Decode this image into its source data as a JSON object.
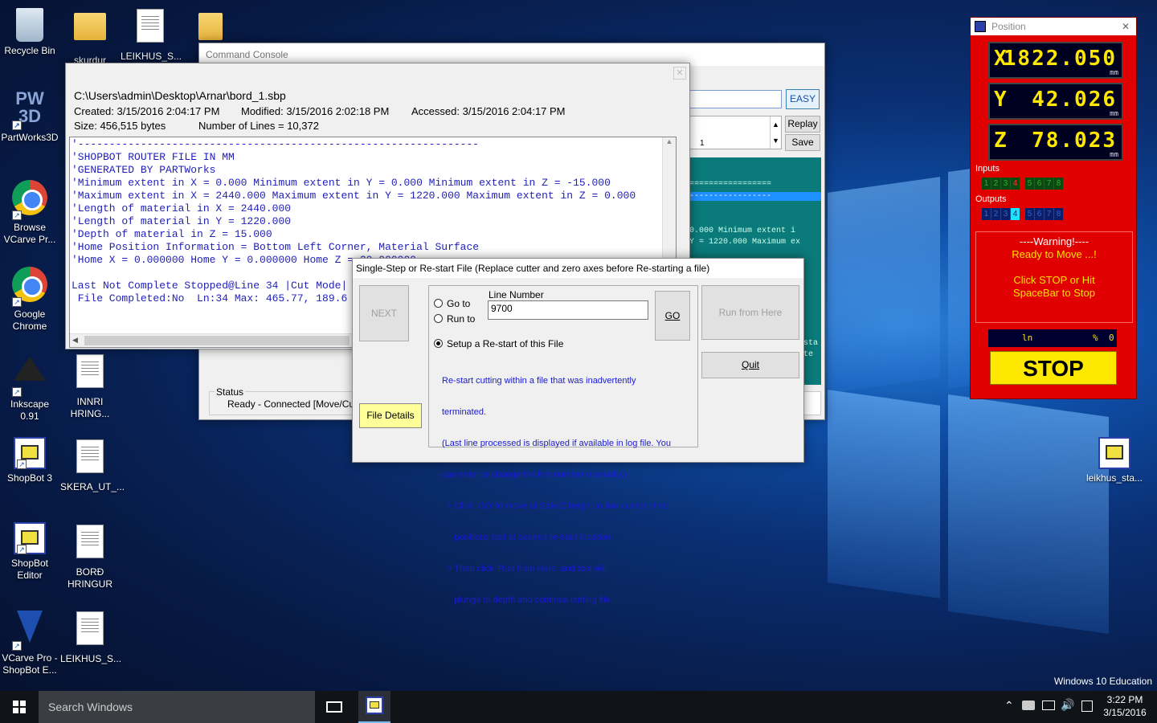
{
  "desktop": {
    "icons": [
      {
        "label": "Recycle Bin",
        "icon": "recycle-bin-icon"
      },
      {
        "label": "skurdur",
        "icon": "folder-icon"
      },
      {
        "label": "LEIKHUS_S...",
        "icon": "document-icon"
      },
      {
        "label": "PartWorks3D",
        "icon": "partworks-icon",
        "glyph": "PW 3D"
      },
      {
        "label": "Browse VCarve Pr...",
        "icon": "chrome-icon"
      },
      {
        "label": "Google Chrome",
        "icon": "chrome-icon"
      },
      {
        "label": "Inkscape 0.91",
        "icon": "inkscape-icon"
      },
      {
        "label": "INNRI HRING...",
        "icon": "document-icon"
      },
      {
        "label": "ShopBot 3",
        "icon": "shopbot-icon"
      },
      {
        "label": "SKERA_UT_...",
        "icon": "document-icon"
      },
      {
        "label": "ShopBot Editor",
        "icon": "shopbot-icon"
      },
      {
        "label": "BORÐ HRINGUR",
        "icon": "document-icon"
      },
      {
        "label": "VCarve Pro - ShopBot E...",
        "icon": "vcarve-icon"
      },
      {
        "label": "LEIKHUS_S...",
        "icon": "document-icon"
      },
      {
        "label": "leikhus_sta...",
        "icon": "shopbot-icon"
      }
    ],
    "watermark": "Windows 10 Education"
  },
  "console": {
    "title": "Command Console",
    "easy": "EASY",
    "replay": "Replay",
    "save": "Save",
    "line_field": "1",
    "behind_text": [
      "=================",
      "-----------------",
      "0.000 Minimum extent i",
      "Y = 1220.000 Maximum ex",
      "sta",
      "te"
    ],
    "status_label": "Status",
    "status_text": "Ready - Connected  [Move/Cu"
  },
  "file_details": {
    "path": "C:\\Users\\admin\\Desktop\\Arnar\\bord_1.sbp",
    "created": "Created: 3/15/2016 2:04:17 PM",
    "modified": "Modified: 3/15/2016 2:02:18 PM",
    "accessed": "Accessed: 3/15/2016 2:04:17 PM",
    "size": "Size: 456,515 bytes",
    "lines": "Number of Lines = 10,372",
    "content": [
      "'----------------------------------------------------------------",
      "'SHOPBOT ROUTER FILE IN MM",
      "'GENERATED BY PARTWorks",
      "'Minimum extent in X = 0.000 Minimum extent in Y = 0.000 Minimum extent in Z = -15.000",
      "'Maximum extent in X = 2440.000 Maximum extent in Y = 1220.000 Maximum extent in Z = 0.000",
      "'Length of material in X = 2440.000",
      "'Length of material in Y = 1220.000",
      "'Depth of material in Z = 15.000",
      "'Home Position Information = Bottom Left Corner, Material Surface",
      "'Home X = 0.000000 Home Y = 0.000000 Home Z = 20.000000",
      "",
      "Last Not Complete Stopped@Line 34 |Cut Mode|",
      " File Completed:No  Ln:34 Max: 465.77, 189.6"
    ]
  },
  "restart_dialog": {
    "title": "Single-Step or Re-start File (Replace cutter and zero axes before Re-starting a file)",
    "next": "NEXT",
    "file_details": "File Details",
    "goto": "Go to",
    "runto": "Run to",
    "line_number_label": "Line Number",
    "line_number_value": "9700",
    "go": "GO",
    "setup_restart": "Setup a Re-start of this File",
    "help": [
      "Re-start cutting within a file that was inadvertently",
      "terminated.",
      "(Last line processed is displayed if available in log file. You",
      "can enter or change the line number manually.)",
      "  > Click 'GO' to move at Safe-Z height to line number that",
      "     positions tool at desired re-start location.",
      "  > Then click 'Run from Here' and tool will",
      "     plunge to depth and continue cutting file."
    ],
    "run_from_here": "Run from Here",
    "quit": "Quit"
  },
  "position": {
    "title": "Position",
    "axes": [
      {
        "label": "X",
        "value": "1822.050",
        "unit": "mm"
      },
      {
        "label": "Y",
        "value": "42.026",
        "unit": "mm"
      },
      {
        "label": "Z",
        "value": "78.023",
        "unit": "mm"
      }
    ],
    "inputs_label": "Inputs",
    "inputs": [
      "1",
      "2",
      "3",
      "4",
      "5",
      "6",
      "7",
      "8"
    ],
    "outputs_label": "Outputs",
    "outputs": [
      "1",
      "2",
      "3",
      "4",
      "5",
      "6",
      "7",
      "8"
    ],
    "warning_title": "----Warning!----",
    "warning_line1": "Ready to Move ...!",
    "warning_line2": "Click STOP or Hit",
    "warning_line3": "SpaceBar to Stop",
    "status_ln": "ln",
    "status_pct": "%",
    "status_zero": "0",
    "stop": "STOP",
    "colors": {
      "panel": "#e00000",
      "stop": "#ffe800",
      "active_input": "#ff3030",
      "active_output": "#20e0ff"
    }
  },
  "taskbar": {
    "search_placeholder": "Search Windows",
    "time": "3:22 PM",
    "date": "3/15/2016"
  }
}
